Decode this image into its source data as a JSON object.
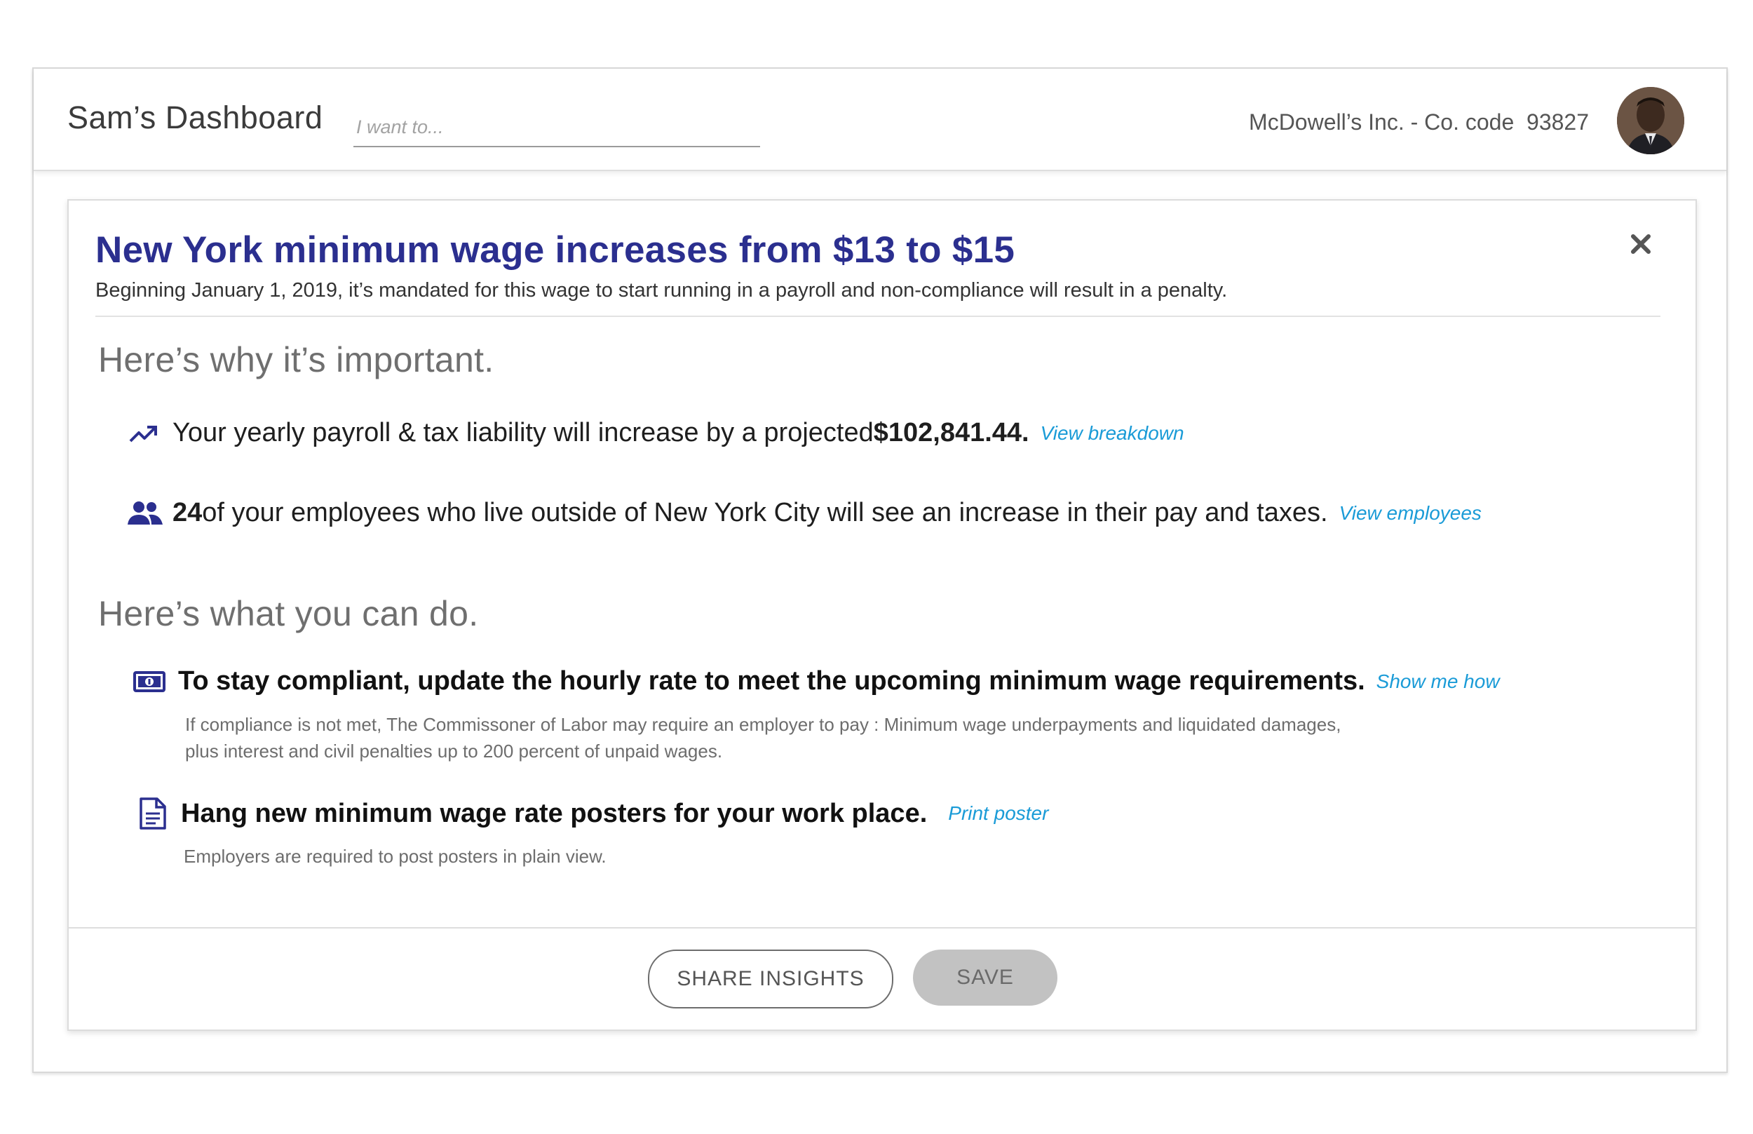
{
  "header": {
    "title": "Sam’s Dashboard",
    "search_placeholder": "I want to...",
    "company": "McDowell’s Inc. - Co. code  93827"
  },
  "alert": {
    "title": "New York minimum wage increases from $13 to $15",
    "subtitle": "Beginning January 1, 2019, it’s mandated for this wage to start running in a payroll and non-compliance will result in a penalty."
  },
  "why": {
    "heading": "Here’s why it’s important.",
    "items": [
      {
        "icon": "trending-up-icon",
        "text": "Your yearly payroll & tax liability will increase by a projected ",
        "highlight": "$102,841.44.",
        "link": "View breakdown"
      },
      {
        "icon": "people-icon",
        "highlight": "24",
        "text": " of your employees who live outside of New York City will see an increase in their pay and taxes.",
        "link": "View employees"
      }
    ]
  },
  "actions": {
    "heading": "Here’s what you can do.",
    "items": [
      {
        "icon": "money-icon",
        "text": "To stay compliant, update the hourly rate to meet the upcoming minimum wage requirements.",
        "link": "Show me how",
        "note_line1": "If compliance is not met, The Commissoner of Labor may require an employer to pay : Minimum wage underpayments and liquidated damages,",
        "note_line2": "plus interest and civil penalties up to 200 percent of unpaid wages."
      },
      {
        "icon": "document-icon",
        "text": "Hang new minimum wage rate posters for your work place.",
        "link": "Print poster",
        "note_line1": "Employers are required to post posters in plain view."
      }
    ]
  },
  "footer": {
    "share_label": "SHARE INSIGHTS",
    "save_label": "SAVE"
  },
  "colors": {
    "brand_navy": "#2b2f8f",
    "link_blue": "#1a9bd7",
    "disabled_gray": "#c2c2c2"
  }
}
